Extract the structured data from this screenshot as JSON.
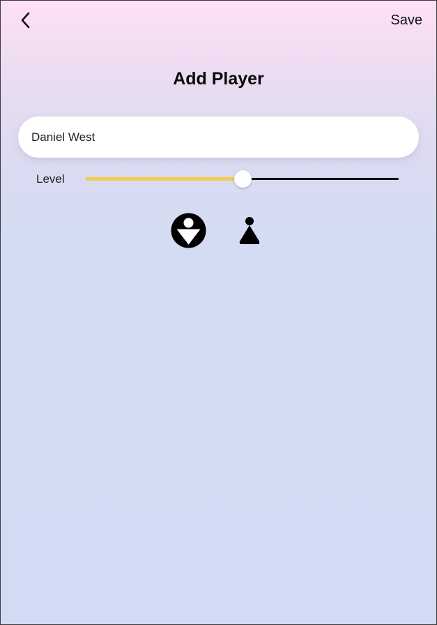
{
  "header": {
    "back_icon": "chevron-left-icon",
    "save_label": "Save"
  },
  "page": {
    "title": "Add Player"
  },
  "form": {
    "name_value": "Daniel West",
    "level_label": "Level",
    "level_value": 0.5
  },
  "gender_options": [
    {
      "icon": "male-player-icon",
      "selected": true
    },
    {
      "icon": "female-player-icon",
      "selected": false
    }
  ],
  "colors": {
    "slider_active": "#f6cc4e",
    "slider_inactive": "#111111",
    "gradient_top": "#ffdff6",
    "gradient_bottom": "#d1dbf3"
  }
}
